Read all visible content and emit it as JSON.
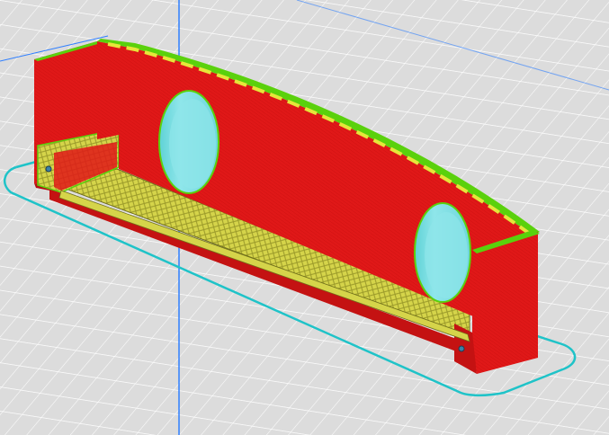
{
  "viewport": {
    "kind": "3d-slicer-preview",
    "model": "sliced-part-preview",
    "colors": {
      "background": "#d9d9d9",
      "build_plate": "#e6e6e6",
      "grid_line": "#ffffff",
      "axis_line": "#2f7fff",
      "wall_outer": "#e01818",
      "wall_outer_dark": "#c41212",
      "infill": "#d8d84a",
      "infill_dark": "#a9a830",
      "inner_wall": "#5ad10c",
      "skirt_outline": "#1fc3c8",
      "hole_fill": "#8fe6ea",
      "hole_shadow": "#5fd2d6"
    },
    "icons": [
      "skirt-outline",
      "hole-left",
      "hole-right"
    ]
  }
}
